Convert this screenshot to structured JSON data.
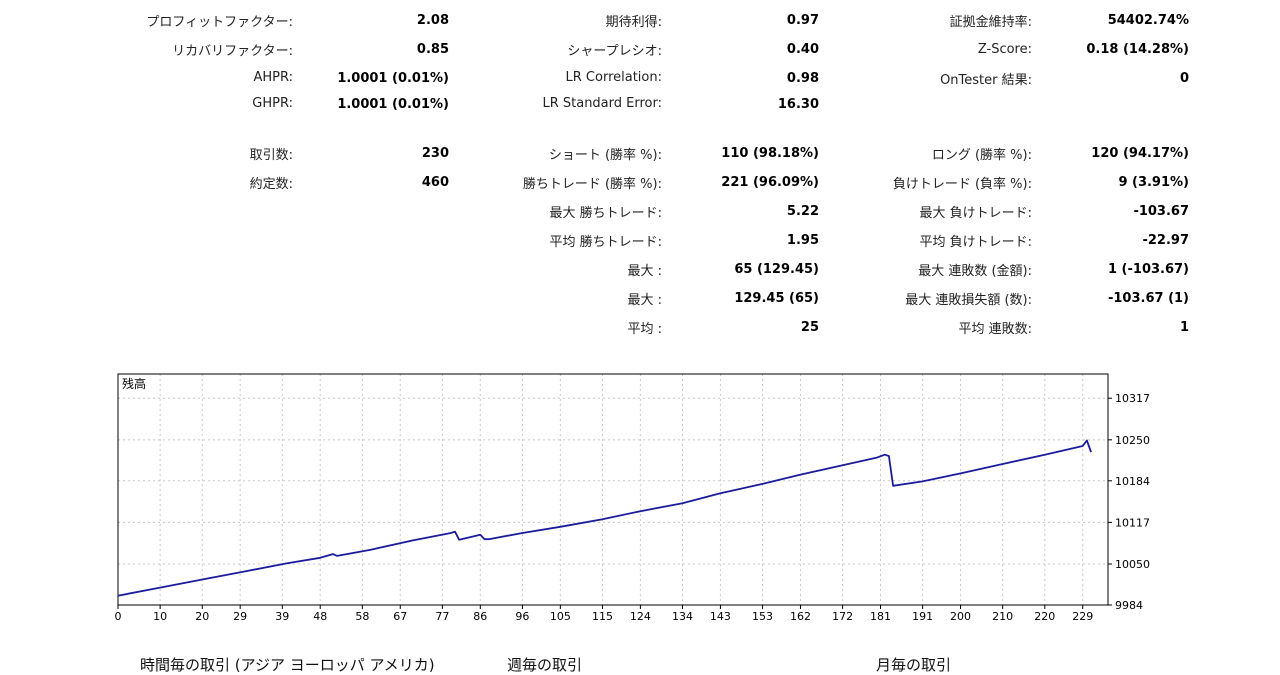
{
  "stats": {
    "col1": [
      {
        "label": "プロフィットファクター:",
        "value": "2.08"
      },
      {
        "label": "リカバリファクター:",
        "value": "0.85"
      },
      {
        "label": "AHPR:",
        "value": "1.0001 (0.01%)"
      },
      {
        "label": "GHPR:",
        "value": "1.0001 (0.01%)"
      },
      {
        "label": "取引数:",
        "value": "230"
      },
      {
        "label": "約定数:",
        "value": "460"
      }
    ],
    "col2": [
      {
        "label": "期待利得:",
        "value": "0.97"
      },
      {
        "label": "シャープレシオ:",
        "value": "0.40"
      },
      {
        "label": "LR Correlation:",
        "value": "0.98"
      },
      {
        "label": "LR Standard Error:",
        "value": "16.30"
      },
      {
        "label": "ショート (勝率 %):",
        "value": "110 (98.18%)"
      },
      {
        "label": "勝ちトレード (勝率 %):",
        "value": "221 (96.09%)"
      },
      {
        "label": "最大 勝ちトレード:",
        "value": "5.22"
      },
      {
        "label": "平均 勝ちトレード:",
        "value": "1.95"
      },
      {
        "label": "最大 :",
        "value": "65 (129.45)"
      },
      {
        "label": "最大 :",
        "value": "129.45 (65)"
      },
      {
        "label": "平均 :",
        "value": "25"
      }
    ],
    "col3": [
      {
        "label": "証拠金維持率:",
        "value": "54402.74%"
      },
      {
        "label": "Z-Score:",
        "value": "0.18 (14.28%)"
      },
      {
        "label": "OnTester 結果:",
        "value": "0"
      },
      {
        "label": "ロング (勝率 %):",
        "value": "120 (94.17%)"
      },
      {
        "label": "負けトレード (負率 %):",
        "value": "9 (3.91%)"
      },
      {
        "label": "最大 負けトレード:",
        "value": "-103.67"
      },
      {
        "label": "平均 負けトレード:",
        "value": "-22.97"
      },
      {
        "label": "最大 連敗数 (金額):",
        "value": "1 (-103.67)"
      },
      {
        "label": "最大 連敗損失額 (数):",
        "value": "-103.67 (1)"
      },
      {
        "label": "平均 連敗数:",
        "value": "1"
      }
    ]
  },
  "chart_data": {
    "type": "line",
    "title": "残高",
    "x_ticks": [
      0,
      10,
      20,
      29,
      39,
      48,
      58,
      67,
      77,
      86,
      96,
      105,
      115,
      124,
      134,
      143,
      153,
      162,
      172,
      181,
      191,
      200,
      210,
      220,
      229
    ],
    "y_ticks": [
      9984,
      10050,
      10117,
      10184,
      10250,
      10317
    ],
    "xlim": [
      0,
      235
    ],
    "ylim": [
      9984,
      10356
    ],
    "grid": true,
    "line_color": "#1b1b9c",
    "series": [
      {
        "name": "",
        "x": [
          0,
          10,
          20,
          30,
          40,
          48,
          51,
          52,
          60,
          70,
          79,
          80,
          81,
          86,
          87,
          88,
          96,
          105,
          115,
          124,
          134,
          143,
          153,
          162,
          172,
          180,
          182,
          183,
          184,
          191,
          200,
          210,
          220,
          229,
          230,
          231
        ],
        "y": [
          9999,
          10012,
          10025,
          10038,
          10051,
          10060,
          10066,
          10063,
          10073,
          10088,
          10100,
          10102,
          10089,
          10097,
          10090,
          10090,
          10100,
          10110,
          10122,
          10135,
          10148,
          10164,
          10179,
          10194,
          10209,
          10221,
          10226,
          10224,
          10176,
          10183,
          10196,
          10211,
          10226,
          10240,
          10249,
          10230
        ]
      }
    ]
  },
  "bottom_headings": [
    "時間毎の取引 (アジア ヨーロッパ アメリカ)",
    "週毎の取引",
    "月毎の取引"
  ]
}
